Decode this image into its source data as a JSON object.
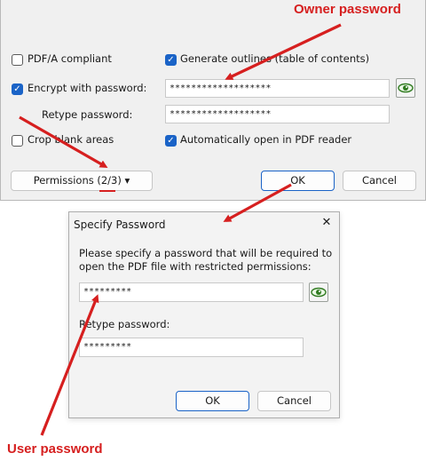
{
  "options": {
    "pdfa_label": "PDF/A compliant",
    "pdfa_checked": false,
    "outlines_label": "Generate outlines (table of contents)",
    "outlines_checked": true,
    "encrypt_label": "Encrypt with password:",
    "encrypt_checked": true,
    "owner_password_value": "*******************",
    "retype_label": "Retype password:",
    "retype_value": "*******************",
    "crop_label": "Crop blank areas",
    "crop_checked": false,
    "autoopen_label": "Automatically open in PDF reader",
    "autoopen_checked": true
  },
  "buttons": {
    "permissions_label": "Permissions (2/3)",
    "ok_label": "OK",
    "cancel_label": "Cancel"
  },
  "dialog": {
    "title": "Specify Password",
    "description_line1": "Please specify a password that will be required to",
    "description_line2": "open the PDF file with restricted permissions:",
    "password_value": "*********",
    "retype_label": "Retype password:",
    "retype_value": "*********",
    "ok_label": "OK",
    "cancel_label": "Cancel",
    "close_glyph": "✕"
  },
  "annotations": {
    "owner_label": "Owner password",
    "user_label": "User password",
    "color": "#d61f1f"
  },
  "icons": {
    "checkmark": "✓",
    "dropdown_caret": "▾"
  }
}
